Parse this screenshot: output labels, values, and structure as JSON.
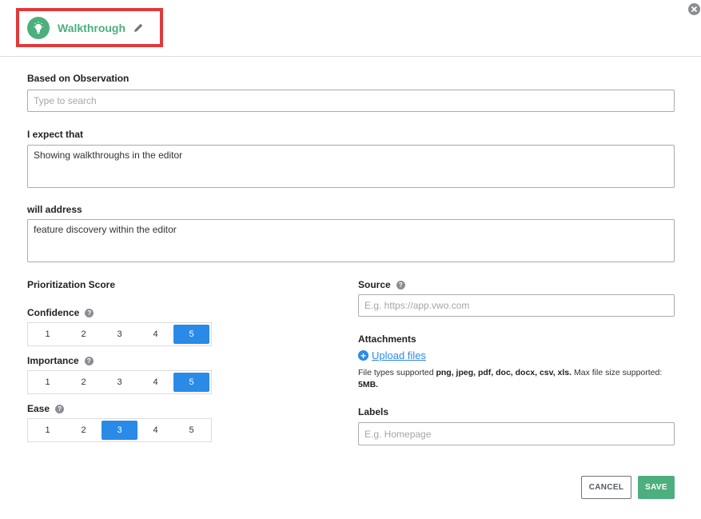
{
  "header": {
    "title": "Walkthrough",
    "icon": "lightbulb-icon",
    "edit_icon": "pencil-icon",
    "close_icon": "close-circle-icon"
  },
  "observation": {
    "label": "Based on Observation",
    "placeholder": "Type to search",
    "value": ""
  },
  "expect": {
    "label": "I expect that",
    "value": "Showing walkthroughs in the editor"
  },
  "address": {
    "label": "will address",
    "value": "feature discovery within the editor"
  },
  "prioritization": {
    "title": "Prioritization Score",
    "scales": [
      {
        "label": "Confidence",
        "options": [
          "1",
          "2",
          "3",
          "4",
          "5"
        ],
        "selected": "5"
      },
      {
        "label": "Importance",
        "options": [
          "1",
          "2",
          "3",
          "4",
          "5"
        ],
        "selected": "5"
      },
      {
        "label": "Ease",
        "options": [
          "1",
          "2",
          "3",
          "4",
          "5"
        ],
        "selected": "3"
      }
    ]
  },
  "source": {
    "label": "Source",
    "placeholder": "E.g. https://app.vwo.com",
    "value": ""
  },
  "attachments": {
    "label": "Attachments",
    "upload_label": "Upload files",
    "info_prefix": "File types supported ",
    "info_types": "png, jpeg, pdf, doc, docx, csv, xls.",
    "info_middle": " Max file size supported: ",
    "info_size": "5MB."
  },
  "labels": {
    "label": "Labels",
    "placeholder": "E.g. Homepage",
    "value": ""
  },
  "actions": {
    "cancel": "CANCEL",
    "save": "SAVE"
  },
  "colors": {
    "brand_green": "#4caf7d",
    "accent_blue": "#2a8ae8",
    "highlight_red": "#e0393b"
  }
}
